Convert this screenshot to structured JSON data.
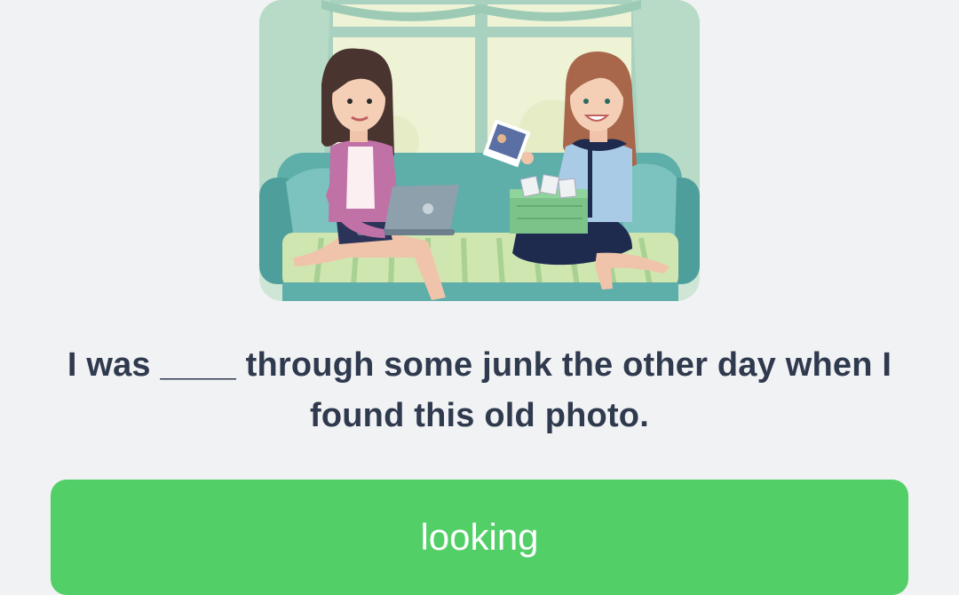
{
  "question": {
    "sentence": "I was ____ through some junk the other day when I found this old photo."
  },
  "answer_option": {
    "label": "looking"
  },
  "colors": {
    "background": "#f1f2f4",
    "text": "#2f3a4e",
    "answer_button": "#53cf68",
    "answer_text": "#ffffff"
  }
}
